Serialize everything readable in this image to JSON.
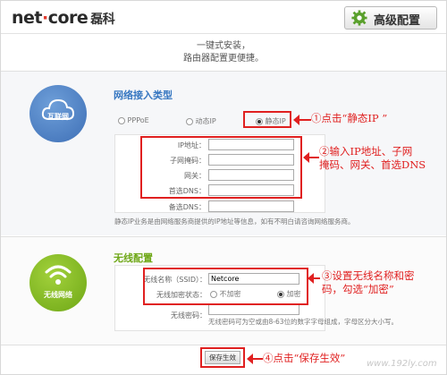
{
  "header": {
    "logo_text": "net",
    "logo_dot": "·",
    "logo_text2": "core",
    "logo_cn": "磊科",
    "advanced_button": "高级配置"
  },
  "tagline": {
    "line1": "一键式安装，",
    "line2": "路由器配置更便捷。"
  },
  "wan": {
    "icon_label": "互联网",
    "title": "网络接入类型",
    "options": [
      {
        "label": "PPPoE",
        "selected": false
      },
      {
        "label": "动态IP",
        "selected": false
      },
      {
        "label": "静态IP",
        "selected": true
      }
    ],
    "fields": {
      "ip_label": "IP地址：",
      "mask_label": "子网掩码：",
      "gateway_label": "网关：",
      "dns1_label": "首选DNS：",
      "dns2_label": "备选DNS："
    },
    "note": "静态IP业务是由网络服务商提供的IP地址等信息，如有不明白请咨询网络服务商。"
  },
  "wireless": {
    "icon_label": "无线网络",
    "title": "无线配置",
    "ssid_label": "无线名称（SSID）：",
    "ssid_value": "Netcore",
    "enc_label": "无线加密状态：",
    "enc_options": [
      {
        "label": "不加密",
        "selected": false
      },
      {
        "label": "加密",
        "selected": true
      }
    ],
    "pwd_label": "无线密码：",
    "pwd_note": "无线密码可为空或由8-63位的数字字母组成，字母区分大小写。"
  },
  "save_button": "保存生效",
  "annotations": {
    "a1": "①点击“静态IP ”",
    "a2_line1": "②输入IP地址、子网",
    "a2_line2": "掩码、网关、首选DNS",
    "a3_line1": "③设置无线名称和密",
    "a3_line2": "码，勾选“加密”",
    "a4": "④点击“保存生效”"
  },
  "watermark": "www.192ly.com",
  "colors": {
    "accent_blue": "#3777c1",
    "annotation_red": "#e02020",
    "wan_icon": "#4a7cc0",
    "wifi_icon": "#7fb521"
  }
}
